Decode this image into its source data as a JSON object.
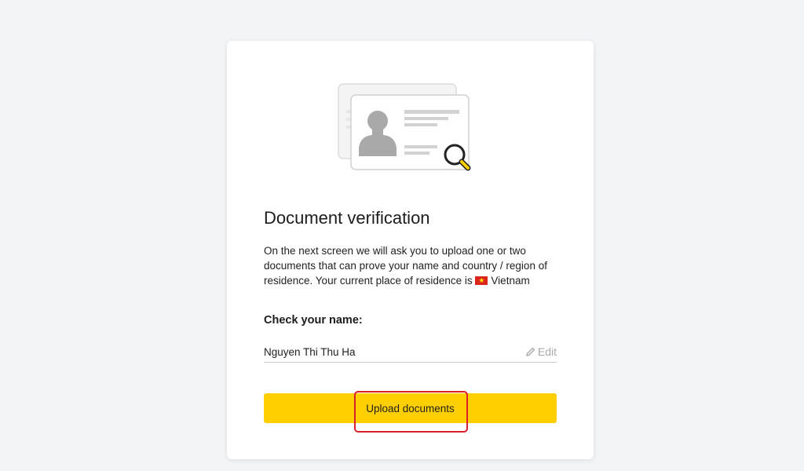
{
  "card": {
    "title": "Document verification",
    "description": "On the next screen we will ask you to upload one or two documents that can prove your name and country / region of residence. Your current place of residence is",
    "country": "Vietnam",
    "check_name_label": "Check your name:",
    "name_value": "Nguyen Thi Thu Ha",
    "edit_label": "Edit",
    "upload_button_label": "Upload documents"
  },
  "colors": {
    "accent": "#ffcf00",
    "highlight": "#d9202a",
    "background": "#f3f4f6"
  },
  "icons": [
    "id-card-illustration",
    "magnifier-icon",
    "vietnam-flag-icon",
    "pencil-icon"
  ]
}
